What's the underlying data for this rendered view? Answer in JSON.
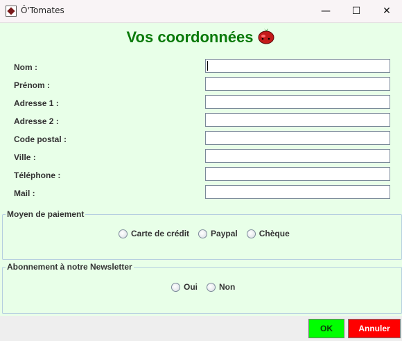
{
  "window": {
    "title": "Ô'Tomates",
    "controls": {
      "minimize": "—",
      "maximize": "☐",
      "close": "✕"
    }
  },
  "form": {
    "heading": "Vos coordonnées",
    "heading_icon": "tomato-icon",
    "fields": [
      {
        "label": "Nom :",
        "value": ""
      },
      {
        "label": "Prénom :",
        "value": ""
      },
      {
        "label": "Adresse 1 :",
        "value": ""
      },
      {
        "label": "Adresse 2 :",
        "value": ""
      },
      {
        "label": "Code postal :",
        "value": ""
      },
      {
        "label": "Ville :",
        "value": ""
      },
      {
        "label": "Téléphone :",
        "value": ""
      },
      {
        "label": "Mail :",
        "value": ""
      }
    ]
  },
  "payment": {
    "legend": "Moyen de paiement",
    "options": [
      "Carte de crédit",
      "Paypal",
      "Chèque"
    ],
    "selected": null
  },
  "newsletter": {
    "legend": "Abonnement à notre Newsletter",
    "options": [
      "Oui",
      "Non"
    ],
    "selected": null
  },
  "buttons": {
    "ok": "OK",
    "cancel": "Annuler"
  },
  "colors": {
    "content_bg": "#e8ffe8",
    "heading": "#0a7a0a",
    "ok_button": "#00ff00",
    "cancel_button": "#ff0000"
  }
}
